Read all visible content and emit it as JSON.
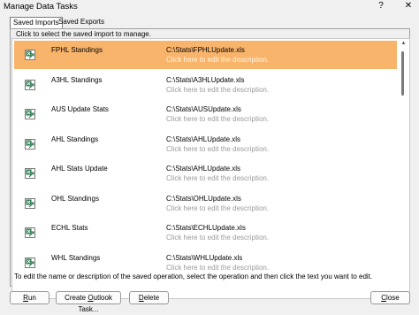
{
  "window": {
    "title": "Manage Data Tasks",
    "help_label": "?",
    "close_label": "✕"
  },
  "tabs": [
    {
      "label": "Saved Imports",
      "active": true
    },
    {
      "label": "Saved Exports",
      "active": false
    }
  ],
  "instruction": "Click to select the saved import to manage.",
  "rows": [
    {
      "name": "FPHL Standings",
      "path": "C:\\Stats\\FPHLUpdate.xls",
      "desc": "Click here to edit the description.",
      "selected": true
    },
    {
      "name": "A3HL Standings",
      "path": "C:\\Stats\\A3HLUpdate.xls",
      "desc": "Click here to edit the description.",
      "selected": false
    },
    {
      "name": "AUS Update Stats",
      "path": "C:\\Stats\\AUSUpdate.xls",
      "desc": "Click here to edit the description.",
      "selected": false
    },
    {
      "name": "AHL Standings",
      "path": "C:\\Stats\\AHLUpdate.xls",
      "desc": "Click here to edit the description.",
      "selected": false
    },
    {
      "name": "AHL Stats Update",
      "path": "C:\\Stats\\AHLUpdate.xls",
      "desc": "Click here to edit the description.",
      "selected": false
    },
    {
      "name": "OHL Standings",
      "path": "C:\\Stats\\OHLUpdate.xls",
      "desc": "Click here to edit the description.",
      "selected": false
    },
    {
      "name": "ECHL Stats",
      "path": "C:\\Stats\\ECHLUpdate.xls",
      "desc": "Click here to edit the description.",
      "selected": false
    },
    {
      "name": "WHL Standings",
      "path": "C:\\Stats\\WHLUpdate.xls",
      "desc": "Click here to edit the description.",
      "selected": false
    }
  ],
  "footer_text": "To edit the name or description of the saved operation, select the operation and then click the text you want to edit.",
  "buttons": {
    "run": {
      "pre": "",
      "key": "R",
      "post": "un"
    },
    "outlook": {
      "pre": "Create ",
      "key": "O",
      "post": "utlook Task..."
    },
    "delete": {
      "pre": "",
      "key": "D",
      "post": "elete"
    },
    "close": {
      "pre": "",
      "key": "C",
      "post": "lose"
    }
  },
  "icons": {
    "row_icon": "excel-import-icon"
  },
  "colors": {
    "selected_row": "#f9b46c",
    "description_text": "#9a9a9a",
    "icon_green": "#217346"
  }
}
